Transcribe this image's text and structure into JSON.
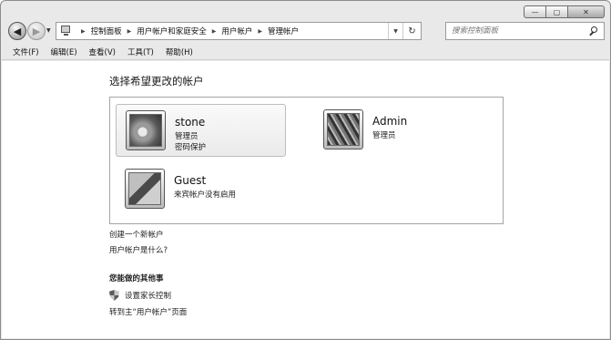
{
  "caption": {
    "minimize": "▭",
    "maximize": "▢",
    "close": "✕"
  },
  "nav": {
    "back_icon": "arrow-left-icon",
    "forward_icon": "arrow-right-icon",
    "breadcrumbs": [
      "控制面板",
      "用户帐户和家庭安全",
      "用户帐户",
      "管理帐户"
    ],
    "refresh_label": "↻",
    "search_placeholder": "搜索控制面板"
  },
  "menu": [
    "文件(F)",
    "编辑(E)",
    "查看(V)",
    "工具(T)",
    "帮助(H)"
  ],
  "main": {
    "heading": "选择希望更改的帐户",
    "accounts": [
      {
        "name": "stone",
        "lines": [
          "管理员",
          "密码保护"
        ],
        "picture": "flower",
        "selected": true
      },
      {
        "name": "Admin",
        "lines": [
          "管理员"
        ],
        "picture": "fabric",
        "selected": false
      },
      {
        "name": "Guest",
        "lines": [
          "来宾帐户没有启用"
        ],
        "picture": "chess",
        "selected": false
      }
    ],
    "links": [
      "创建一个新帐户",
      "用户帐户是什么?"
    ],
    "other_title": "您能做的其他事",
    "tasks": [
      {
        "label": "设置家长控制",
        "icon": "shield-icon"
      },
      {
        "label": "转到主“用户帐户”页面"
      }
    ]
  }
}
